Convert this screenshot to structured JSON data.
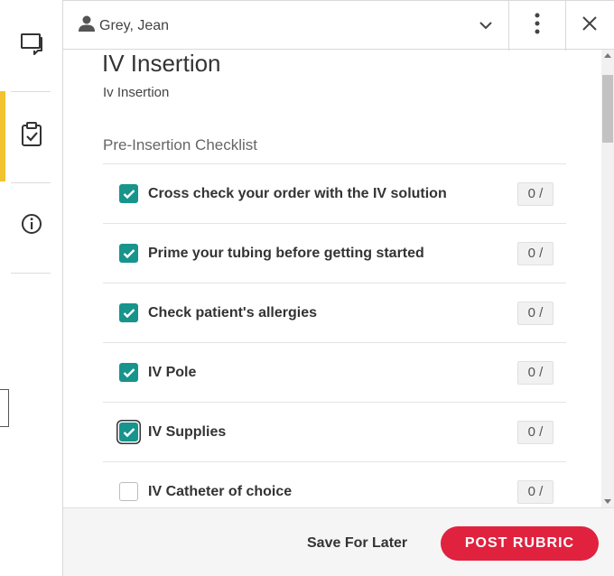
{
  "header": {
    "user_name": "Grey, Jean"
  },
  "rubric": {
    "title": "IV Insertion",
    "subtitle": "Iv Insertion",
    "section_title": "Pre-Insertion Checklist",
    "items": [
      {
        "label": "Cross check your order with the IV solution",
        "checked": true,
        "score": "0 /"
      },
      {
        "label": "Prime your tubing before getting started",
        "checked": true,
        "score": "0 /"
      },
      {
        "label": "Check patient's allergies",
        "checked": true,
        "score": "0 /"
      },
      {
        "label": "IV Pole",
        "checked": true,
        "score": "0 /"
      },
      {
        "label": "IV Supplies",
        "checked": true,
        "score": "0 /"
      },
      {
        "label": "IV Catheter of choice",
        "checked": false,
        "score": "0 /"
      }
    ]
  },
  "footer": {
    "save_later_label": "Save For Later",
    "post_label": "POST RUBRIC"
  },
  "colors": {
    "accent_teal": "#17948c",
    "post_red": "#e0223f",
    "active_rail": "#f2c230"
  },
  "icons": {
    "rail": [
      "comment-icon",
      "clipboard-check-icon",
      "info-icon"
    ],
    "header": [
      "user-icon",
      "chevron-down-icon",
      "more-vertical-icon",
      "close-icon"
    ]
  }
}
